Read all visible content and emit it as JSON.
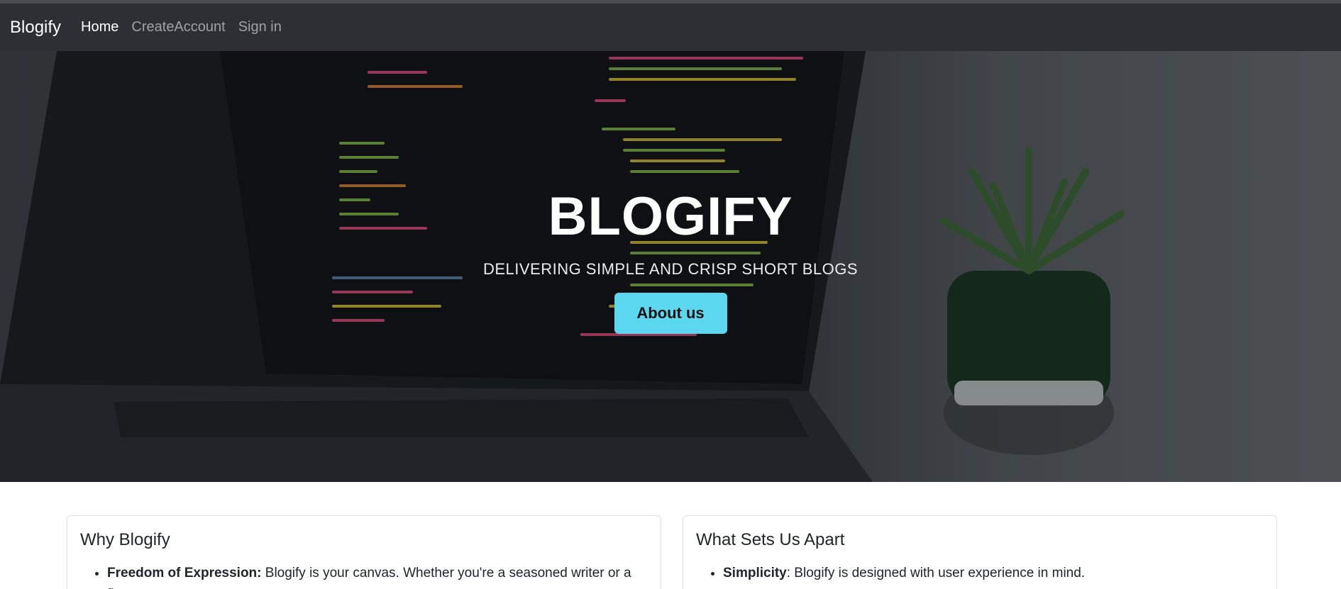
{
  "navbar": {
    "brand": "Blogify",
    "links": [
      {
        "label": "Home",
        "active": true
      },
      {
        "label": "CreateAccount",
        "active": false
      },
      {
        "label": "Sign in",
        "active": false
      }
    ]
  },
  "hero": {
    "title": "BLOGIFY",
    "subtitle": "DELIVERING SIMPLE AND CRISP SHORT BLOGS",
    "button_label": "About us",
    "button_color": "#5bd7ef"
  },
  "cards": [
    {
      "title": "Why Blogify",
      "items": [
        {
          "term": "Freedom of Expression:",
          "text": " Blogify is your canvas. Whether you're a seasoned writer or a first-"
        }
      ]
    },
    {
      "title": "What Sets Us Apart",
      "items": [
        {
          "term": "Simplicity",
          "text": ": Blogify is designed with user experience in mind."
        }
      ]
    }
  ]
}
